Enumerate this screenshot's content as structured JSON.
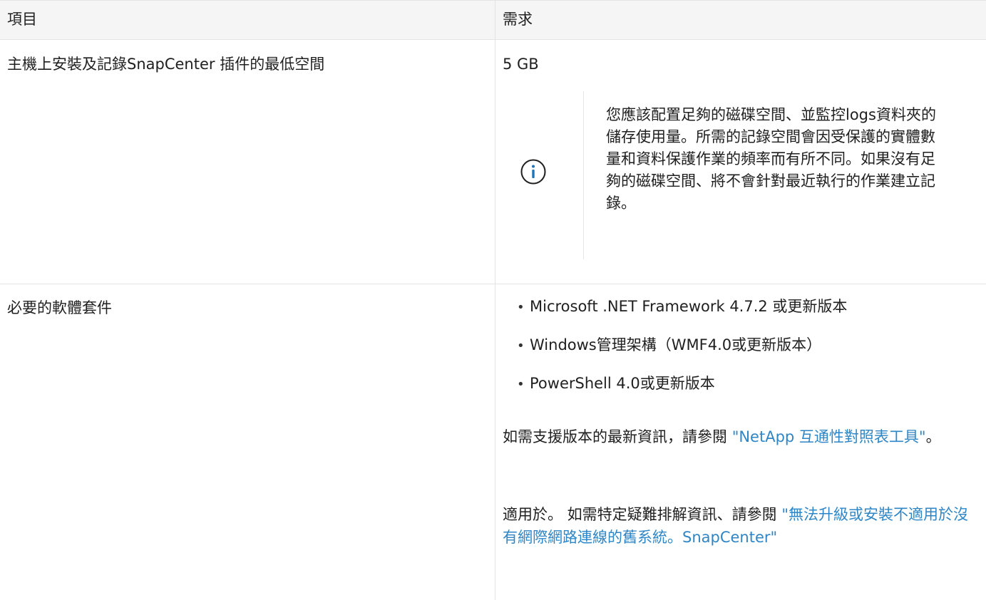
{
  "table": {
    "header": {
      "item": "項目",
      "requirement": "需求"
    },
    "rows": [
      {
        "item": "主機上安裝及記錄SnapCenter 插件的最低空間",
        "requirement": "5 GB",
        "note": {
          "icon": "info-icon",
          "text": "您應該配置足夠的磁碟空間、並監控logs資料夾的儲存使用量。所需的記錄空間會因受保護的實體數量和資料保護作業的頻率而有所不同。如果沒有足夠的磁碟空間、將不會針對最近執行的作業建立記錄。"
        }
      },
      {
        "item": "必要的軟體套件",
        "bullets": [
          "Microsoft .NET Framework 4.7.2 或更新版本",
          "Windows管理架構（WMF4.0或更新版本）",
          "PowerShell 4.0或更新版本"
        ],
        "para1": {
          "prefix": "如需支援版本的最新資訊，請參閱 ",
          "link": "\"NetApp 互通性對照表工具\"",
          "suffix": "。"
        },
        "para2": {
          "prefix": "適用於。 如需特定疑難排解資訊、請參閱 ",
          "link": "\"無法升級或安裝不適用於沒有網際網路連線的舊系統。SnapCenter\""
        }
      }
    ]
  },
  "colors": {
    "link": "#2f86c6",
    "icon": "#1d74b8",
    "header_bg": "#f5f5f5",
    "border": "#e3e3e3"
  }
}
